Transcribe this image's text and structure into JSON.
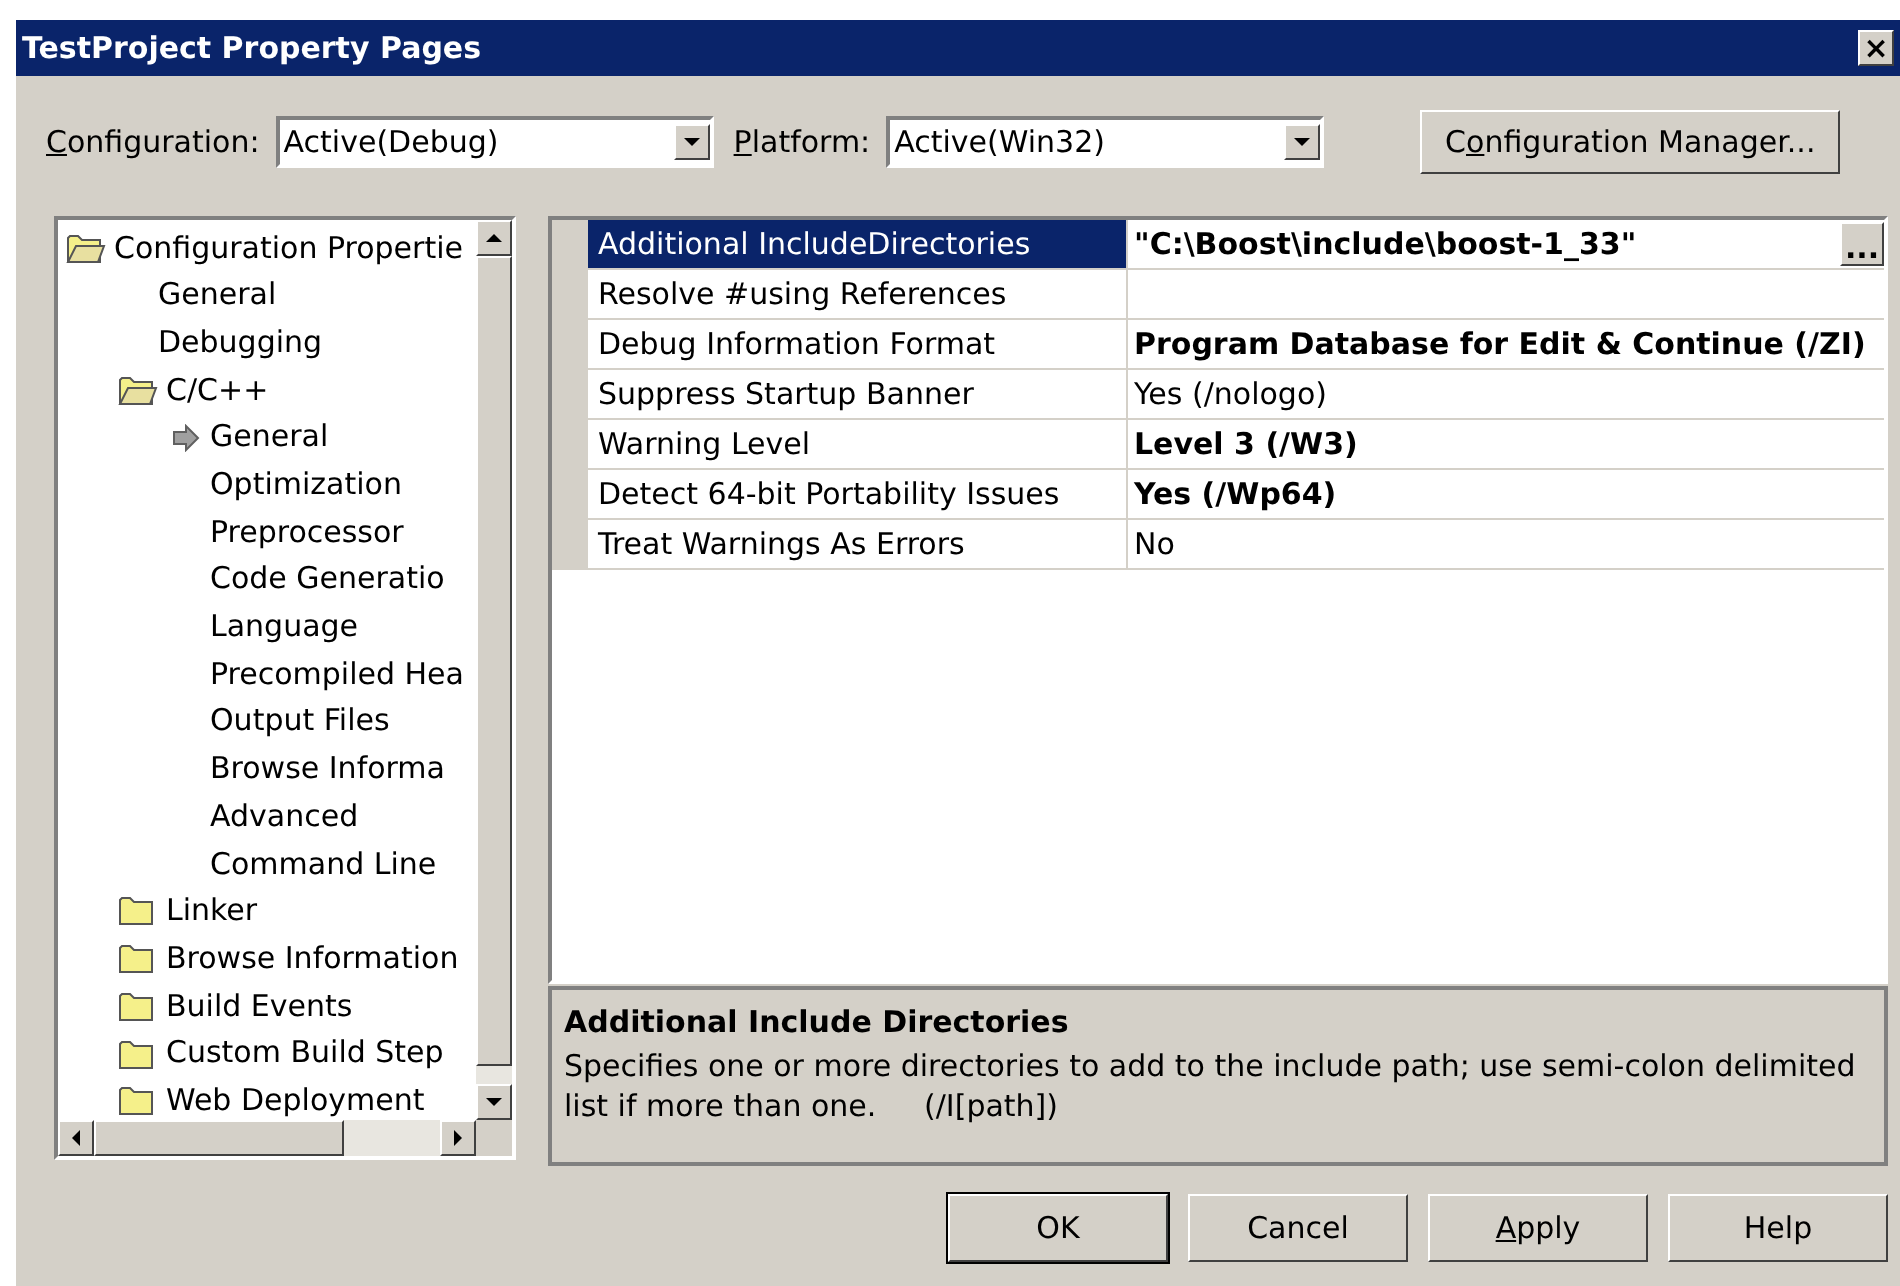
{
  "window": {
    "title": "TestProject Property Pages",
    "close": "×"
  },
  "configuration": {
    "label": {
      "key": "C",
      "after": "onfiguration:"
    },
    "value": "Active(Debug)"
  },
  "platform": {
    "label": {
      "key": "P",
      "after": "latform:"
    },
    "value": "Active(Win32)"
  },
  "configuration_manager": {
    "before": "C",
    "key": "o",
    "after": "nfiguration Manager..."
  },
  "tree": [
    {
      "label": "Configuration Propertie",
      "kind": "open-folder",
      "selected": false,
      "children": [
        {
          "label": "General",
          "kind": "page",
          "selected": false
        },
        {
          "label": "Debugging",
          "kind": "page",
          "selected": false
        },
        {
          "label": "C/C++",
          "kind": "open-folder",
          "selected": false,
          "children": [
            {
              "label": "General",
              "kind": "page",
              "selected": true
            },
            {
              "label": "Optimization",
              "kind": "page",
              "selected": false
            },
            {
              "label": "Preprocessor",
              "kind": "page",
              "selected": false
            },
            {
              "label": "Code Generatio",
              "kind": "page",
              "selected": false
            },
            {
              "label": "Language",
              "kind": "page",
              "selected": false
            },
            {
              "label": "Precompiled Hea",
              "kind": "page",
              "selected": false
            },
            {
              "label": "Output Files",
              "kind": "page",
              "selected": false
            },
            {
              "label": "Browse Informa",
              "kind": "page",
              "selected": false
            },
            {
              "label": "Advanced",
              "kind": "page",
              "selected": false
            },
            {
              "label": "Command Line",
              "kind": "page",
              "selected": false
            }
          ]
        },
        {
          "label": "Linker",
          "kind": "folder",
          "selected": false
        },
        {
          "label": "Browse Information",
          "kind": "folder",
          "selected": false
        },
        {
          "label": "Build Events",
          "kind": "folder",
          "selected": false
        },
        {
          "label": "Custom Build Step",
          "kind": "folder",
          "selected": false
        },
        {
          "label": "Web Deployment",
          "kind": "folder",
          "selected": false
        }
      ]
    }
  ],
  "properties": [
    {
      "name": "Additional IncludeDirectories",
      "value": "\"C:\\Boost\\include\\boost-1_33\"",
      "bold": true,
      "selected": true,
      "browse": "..."
    },
    {
      "name": "Resolve #using References",
      "selected": false
    },
    {
      "name": "Debug Information Format",
      "value": "Program Database for Edit & Continue (/ZI)",
      "bold": true,
      "selected": false
    },
    {
      "name": "Suppress Startup Banner",
      "value": "Yes (/nologo)",
      "bold": false,
      "selected": false
    },
    {
      "name": "Warning Level",
      "value": "Level 3 (/W3)",
      "bold": true,
      "selected": false
    },
    {
      "name": "Detect 64-bit Portability Issues",
      "value": "Yes (/Wp64)",
      "bold": true,
      "selected": false
    },
    {
      "name": "Treat Warnings As Errors",
      "value": "No",
      "bold": false,
      "selected": false
    }
  ],
  "description": {
    "title": "Additional Include Directories",
    "text": "Specifies one or more directories to add to the include path; use semi-colon delimited list if more than one.     (/I[path])"
  },
  "buttons": [
    {
      "after": "OK",
      "default": true
    },
    {
      "after": "Cancel",
      "default": false
    },
    {
      "key": "A",
      "after": "pply",
      "default": false
    },
    {
      "after": "Help",
      "default": false
    }
  ]
}
